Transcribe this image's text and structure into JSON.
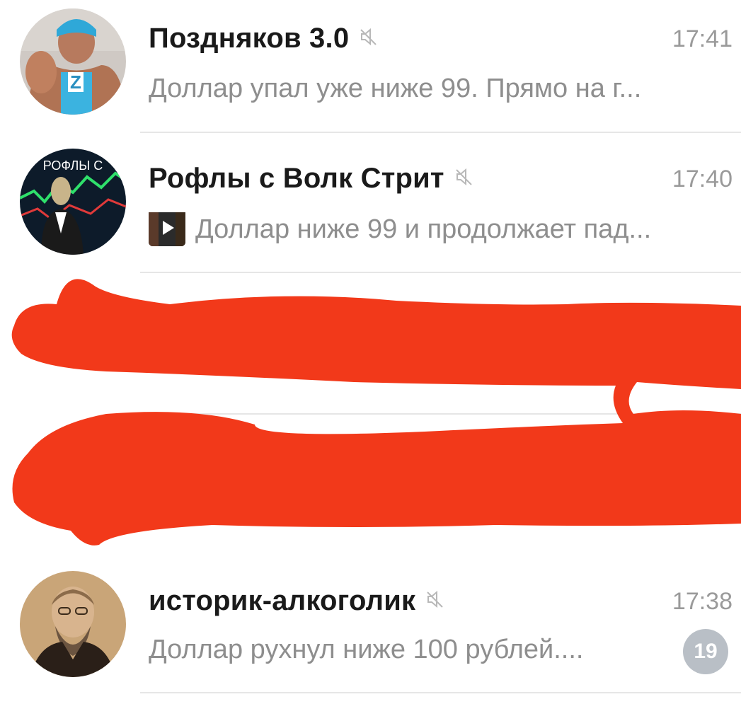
{
  "chats": [
    {
      "name": "Поздняков 3.0",
      "time": "17:41",
      "preview": "Доллар упал уже ниже 99. Прямо на г...",
      "muted": true,
      "avatar": "avatar-athlete-z-icon"
    },
    {
      "name": "Рофлы с Волк Стрит",
      "time": "17:40",
      "preview": "Доллар ниже 99 и продолжает пад...",
      "muted": true,
      "avatar": "avatar-rofly-icon",
      "avatar_text": "РОФЛЫ С",
      "has_media": true
    },
    {
      "name": "историк-алкоголик",
      "time": "17:38",
      "preview": "Доллар рухнул ниже 100 рублей....",
      "muted": true,
      "unread": "19",
      "avatar": "avatar-historian-portrait-icon"
    }
  ],
  "colors": {
    "redaction": "#f2391a",
    "badge": "#b9bfc6",
    "muted_text": "#8e8e8e",
    "divider": "#e6e6e6"
  }
}
